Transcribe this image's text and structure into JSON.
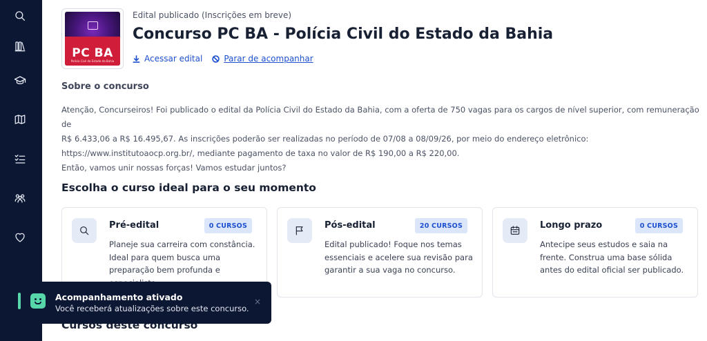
{
  "sidebar": {
    "items": [
      {
        "icon": "search-icon"
      },
      {
        "icon": "library-icon"
      },
      {
        "icon": "graduation-cap-icon"
      },
      {
        "icon": "map-icon"
      },
      {
        "icon": "checklist-icon"
      },
      {
        "icon": "community-icon"
      },
      {
        "icon": "heart-icon"
      }
    ]
  },
  "header": {
    "thumbnail_text": "PC BA",
    "thumbnail_subtext": "Polícia Civil do Estado da Bahia",
    "status": "Edital publicado (Inscrições em breve)",
    "title": "Concurso PC BA - Polícia Civil do Estado da Bahia",
    "access_label": "Acessar edital",
    "unfollow_label": "Parar de acompanhar"
  },
  "about": {
    "heading": "Sobre o concurso",
    "line1": "Atenção, Concurseiros! Foi publicado o edital da Polícia Civil do Estado da Bahia, com a oferta de 750 vagas para os cargos de nível superior, com remuneração de",
    "line2": "R$ 6.433,06 a R$ 16.495,67. As inscrições poderão ser realizadas no período de 07/08 a 08/09/26, por meio do endereço eletrônico:",
    "line3": "https://www.institutoaocp.org.br/, mediante pagamento de taxa no valor de R$ 190,00 a R$ 220,00.",
    "line4": "Então, vamos unir nossas forças! Vamos estudar juntos?"
  },
  "choose": {
    "heading": "Escolha o curso ideal para o seu momento",
    "cards": [
      {
        "title": "Pré-edital",
        "badge": "0 CURSOS",
        "icon": "search-icon",
        "desc": "Planeje sua carreira com constância. Ideal para quem busca uma preparação bem profunda e especialista."
      },
      {
        "title": "Pós-edital",
        "badge": "20 CURSOS",
        "icon": "flag-icon",
        "desc": "Edital publicado! Foque nos temas essenciais e acelere sua revisão para garantir a sua vaga no concurso."
      },
      {
        "title": "Longo prazo",
        "badge": "0 CURSOS",
        "icon": "calendar-icon",
        "desc": "Antecipe seus estudos e saia na frente. Construa uma base sólida antes do edital oficial ser publicado."
      }
    ]
  },
  "courses": {
    "heading": "Cursos deste concurso"
  },
  "toast": {
    "title": "Acompanhamento ativado",
    "desc": "Você receberá atualizações sobre este concurso.",
    "close": "×"
  }
}
